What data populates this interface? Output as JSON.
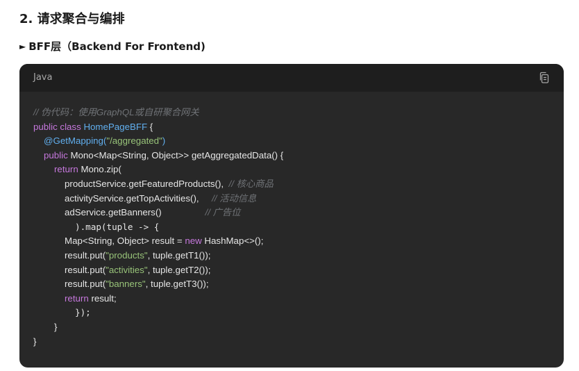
{
  "section": {
    "heading": "2. 请求聚合与编排",
    "subheading_marker": "►",
    "subheading": "BFF层（Backend For Frontend)"
  },
  "code_block": {
    "language": "Java",
    "copy_icon": "copy-icon",
    "tokens": {
      "l1_comment": "// 伪代码：使用GraphQL或自研聚合网关",
      "l2_kw": "public class ",
      "l2_class": "HomePageBFF",
      "l2_rest": " {",
      "l3_ann": "@GetMapping(",
      "l3_str": "\"/aggregated\"",
      "l3_end": ")",
      "l4_kw": "public",
      "l4_rest": " Mono<Map<String, Object>> getAggregatedData() {",
      "l5_kw": "return",
      "l5_rest": " Mono.zip(",
      "l6_code": "productService.getFeaturedProducts(),  ",
      "l6_comment": "// 核心商品",
      "l7_code": "activityService.getTopActivities(),     ",
      "l7_comment": "// 活动信息",
      "l8_code": "adService.getBanners()                 ",
      "l8_comment": "// 广告位",
      "l9_code": ").map(tuple -> {",
      "l10_pre": "Map<String, Object> result = ",
      "l10_kw": "new",
      "l10_rest": " HashMap<>();",
      "l11_pre": "result.put(",
      "l11_str": "\"products\"",
      "l11_rest": ", tuple.getT1());",
      "l12_pre": "result.put(",
      "l12_str": "\"activities\"",
      "l12_rest": ", tuple.getT2());",
      "l13_pre": "result.put(",
      "l13_str": "\"banners\"",
      "l13_rest": ", tuple.getT3());",
      "l14_kw": "return",
      "l14_rest": " result;",
      "l15_code": "});",
      "l16_code": "}",
      "l17_code": "}"
    }
  },
  "colors": {
    "card_bg": "#282828",
    "header_bg": "#1e1e1e",
    "keyword": "#c678dd",
    "type": "#61afef",
    "string": "#98c379",
    "comment": "#6f7276"
  }
}
